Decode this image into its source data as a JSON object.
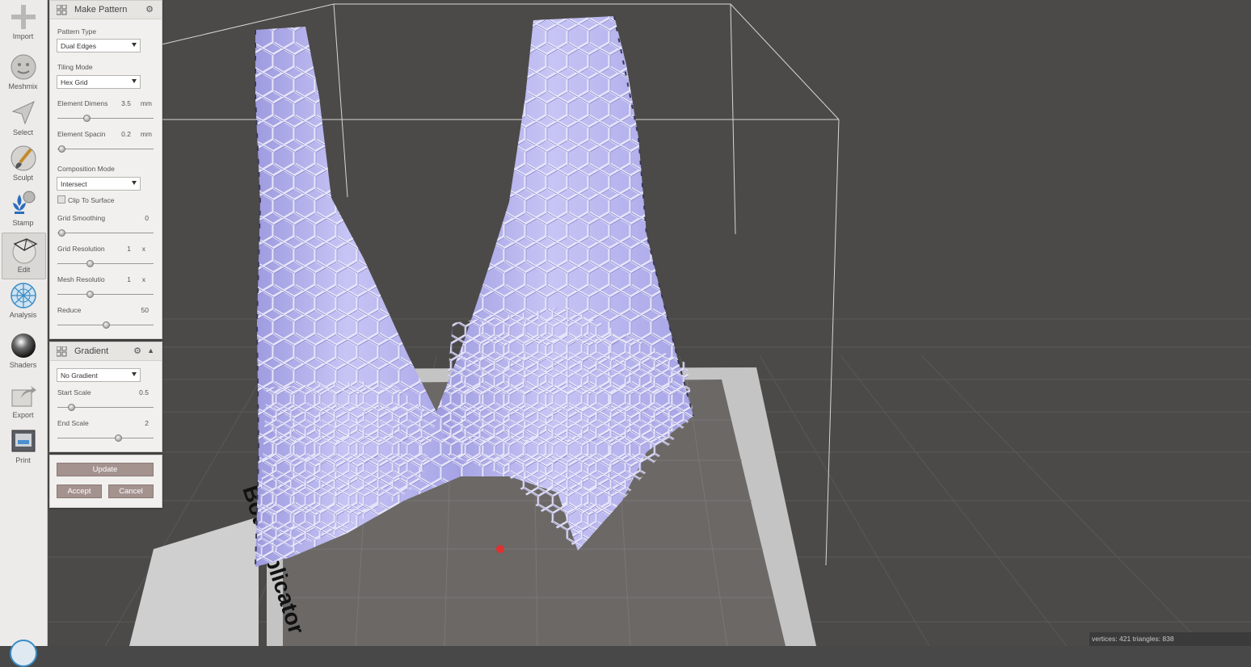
{
  "toolbar": {
    "tools": [
      {
        "label": "Import",
        "icon": "plus-icon"
      },
      {
        "label": "Meshmix",
        "icon": "meshmix-face-icon"
      },
      {
        "label": "Select",
        "icon": "select-arrow-icon"
      },
      {
        "label": "Sculpt",
        "icon": "brush-icon"
      },
      {
        "label": "Stamp",
        "icon": "stamp-fleur-icon"
      },
      {
        "label": "Edit",
        "icon": "edit-cube-icon"
      },
      {
        "label": "Analysis",
        "icon": "analysis-sphere-icon"
      },
      {
        "label": "Shaders",
        "icon": "shader-sphere-icon"
      },
      {
        "label": "Export",
        "icon": "export-icon"
      },
      {
        "label": "Print",
        "icon": "printer-icon"
      }
    ],
    "active": "Edit"
  },
  "make_pattern": {
    "title": "Make Pattern",
    "pattern_type_label": "Pattern Type",
    "pattern_type_value": "Dual Edges",
    "tiling_mode_label": "Tiling Mode",
    "tiling_mode_value": "Hex Grid",
    "element_dimens_label": "Element Dimens",
    "element_dimens_value": "3.5",
    "element_dimens_unit": "mm",
    "element_dimens_slider": 0.3,
    "element_spacing_label": "Element Spacin",
    "element_spacing_value": "0.2",
    "element_spacing_unit": "mm",
    "element_spacing_slider": 0.04,
    "composition_mode_label": "Composition Mode",
    "composition_mode_value": "Intersect",
    "clip_to_surface_label": "Clip To Surface",
    "clip_to_surface_checked": false,
    "grid_smoothing_label": "Grid Smoothing",
    "grid_smoothing_value": "0",
    "grid_smoothing_slider": 0.04,
    "grid_resolution_label": "Grid Resolution",
    "grid_resolution_value": "1",
    "grid_resolution_unit": "x",
    "grid_resolution_slider": 0.34,
    "mesh_resolution_label": "Mesh Resolutio",
    "mesh_resolution_value": "1",
    "mesh_resolution_unit": "x",
    "mesh_resolution_slider": 0.34,
    "reduce_label": "Reduce",
    "reduce_value": "50",
    "reduce_slider": 0.5
  },
  "gradient": {
    "title": "Gradient",
    "mode_value": "No Gradient",
    "start_scale_label": "Start Scale",
    "start_scale_value": "0.5",
    "start_scale_slider": 0.14,
    "end_scale_label": "End Scale",
    "end_scale_value": "2",
    "end_scale_slider": 0.63
  },
  "actions": {
    "update_label": "Update",
    "accept_label": "Accept",
    "cancel_label": "Cancel"
  },
  "viewport": {
    "bed_label": "Bot Replicator",
    "mesh_color": "#b8b5ef",
    "background_color": "#4b4a48"
  },
  "status": {
    "text": "vertices: 421 triangles: 838"
  }
}
